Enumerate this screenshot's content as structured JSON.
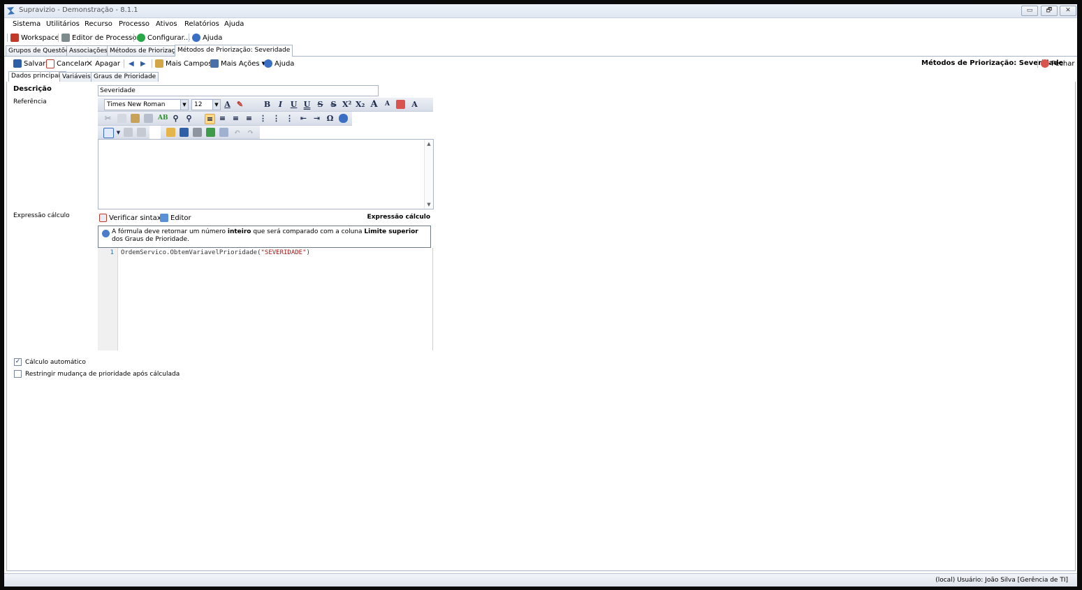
{
  "window": {
    "title": "Supravizio - Demonstração - 8.1.1",
    "controls": [
      "▭",
      "🗗",
      "✕"
    ]
  },
  "menu": [
    "Sistema",
    "Utilitários",
    "Recurso",
    "Processo",
    "Ativos",
    "Relatórios",
    "Ajuda"
  ],
  "main_toolbar": {
    "workspace": "Workspace",
    "process_editor": "Editor de Processos",
    "configure": "Configurar...",
    "help": "Ajuda"
  },
  "document_tabs": [
    "Grupos de Questões",
    "Associações",
    "Métodos de Priorização",
    "Métodos de Priorização: Severidade"
  ],
  "doc_toolbar": {
    "save": "Salvar",
    "cancel": "Cancelar",
    "delete": "Apagar",
    "prev": "◀",
    "next": "▶",
    "more_fields": "Mais Campos",
    "more_actions": "Mais Ações",
    "help": "Ajuda",
    "title": "Métodos de Priorização: Severidade",
    "close": "Fechar"
  },
  "sub_tabs": [
    "Dados principais",
    "Variáveis",
    "Graus de Prioridade"
  ],
  "form": {
    "description_label": "Descrição",
    "description_value": "Severidade",
    "reference_label": "Referência",
    "font_name": "Times New Roman",
    "font_size": "12",
    "expression_label": "Expressão cálculo",
    "verify_syntax": "Verificar sintaxe",
    "editor": "Editor",
    "expression_header": "Expressão cálculo",
    "hint": {
      "part1": "A fórmula deve retornar um número ",
      "bold1": "inteiro",
      "part2": " que será comparado com a coluna ",
      "bold2": "Limite superior",
      "part3": " dos Graus de Prioridade."
    },
    "code": {
      "line_number": "1",
      "prefix": "OrdemServico.ObtemVariavelPrioridade(",
      "string": "\"SEVERIDADE\"",
      "suffix": ")"
    },
    "auto_calc_label": "Cálculo automático",
    "auto_calc_checked": true,
    "restrict_label": "Restringir mudança de prioridade após cálculada",
    "restrict_checked": false
  },
  "status": {
    "text": "(local)   Usuário: João Silva [Gerência de TI]"
  },
  "colors": {
    "accent": "#1d2a4c",
    "border": "#a9b5c6",
    "string": "#a31515"
  }
}
